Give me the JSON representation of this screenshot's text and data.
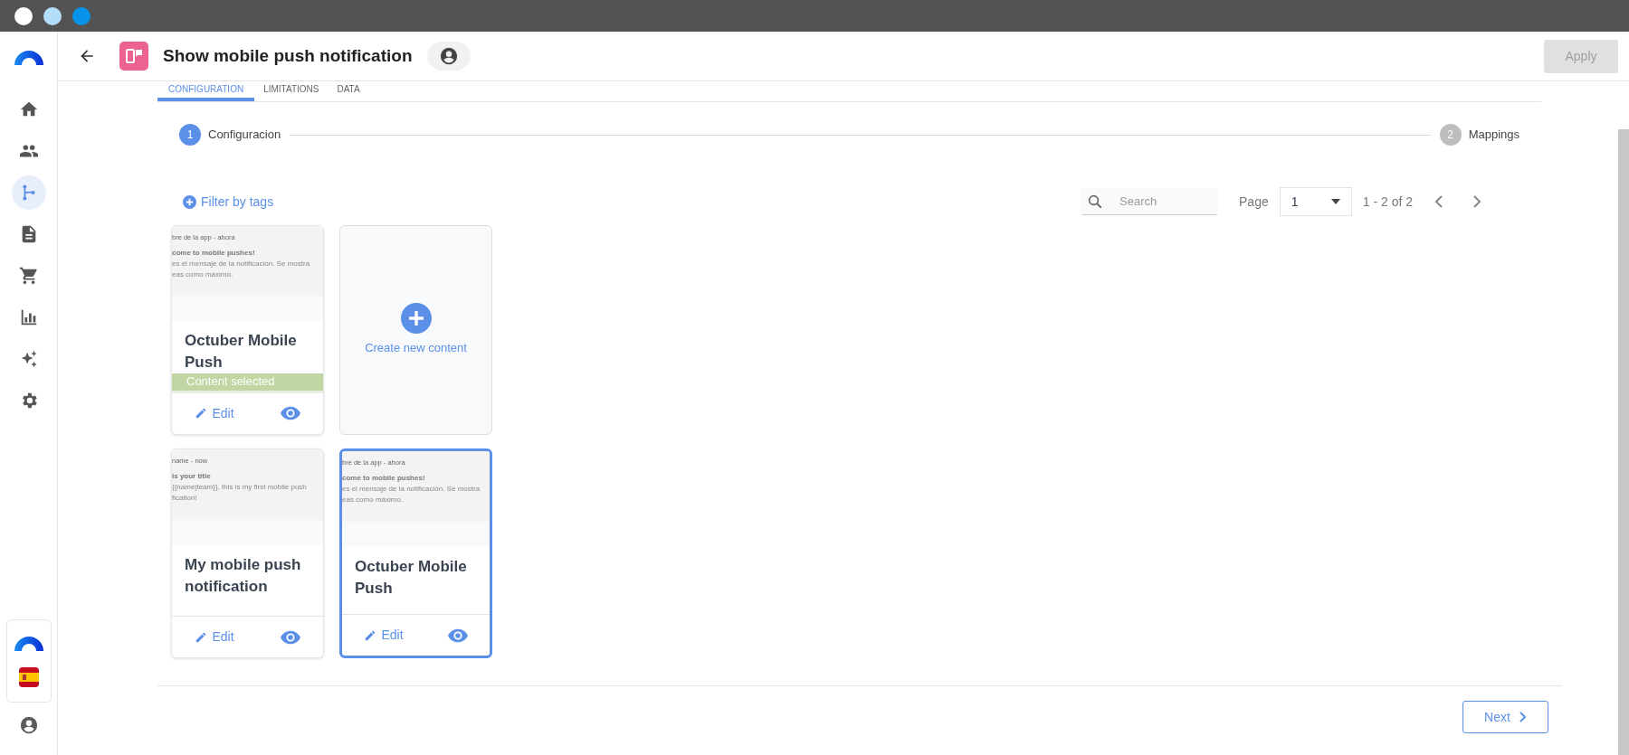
{
  "header": {
    "title": "Show mobile push notification",
    "apply": "Apply"
  },
  "sidebar": {
    "items": [
      {
        "selected": false
      },
      {
        "selected": false
      },
      {
        "selected": true
      },
      {
        "selected": false
      },
      {
        "selected": false
      },
      {
        "selected": false
      },
      {
        "selected": false
      },
      {
        "selected": false
      }
    ]
  },
  "tabs": [
    {
      "label": "CONFIGURATION",
      "selected": true
    },
    {
      "label": "LIMITATIONS",
      "selected": false
    },
    {
      "label": "DATA",
      "selected": false
    }
  ],
  "stepper": [
    {
      "number": "1",
      "label": "Configuracion",
      "selected": true
    },
    {
      "number": "2",
      "label": "Mappings",
      "selected": false
    }
  ],
  "toolbar": {
    "filter": "Filter by tags",
    "search_placeholder": "Search",
    "page_label": "Page",
    "page": "1",
    "range": "1 - 2 of 2"
  },
  "cards": [
    {
      "kind": "content",
      "preview": [
        "bre de la app - ahora",
        "come to mobile pushes!",
        "es el mensaje de la notificación. Se mostra",
        "eas como máximo."
      ],
      "title": "Octuber Mobile Push",
      "status": "Content selected",
      "highlighted": false,
      "edit": "Edit"
    },
    {
      "kind": "create",
      "label": "Create new content"
    },
    {
      "kind": "content",
      "preview": [
        "name - now",
        "is your title",
        "{{name|team}}, this is my first mobile push",
        "fication!"
      ],
      "title": "My mobile push notification",
      "highlighted": false,
      "edit": "Edit"
    },
    {
      "kind": "content",
      "preview": [
        "bre de la app - ahora",
        "come to mobile pushes!",
        "es el mensaje de la notificación. Se mostra",
        "eas como máximo."
      ],
      "title": "Octuber Mobile Push",
      "highlighted": true,
      "edit": "Edit"
    }
  ],
  "footer": {
    "next": "Next"
  }
}
